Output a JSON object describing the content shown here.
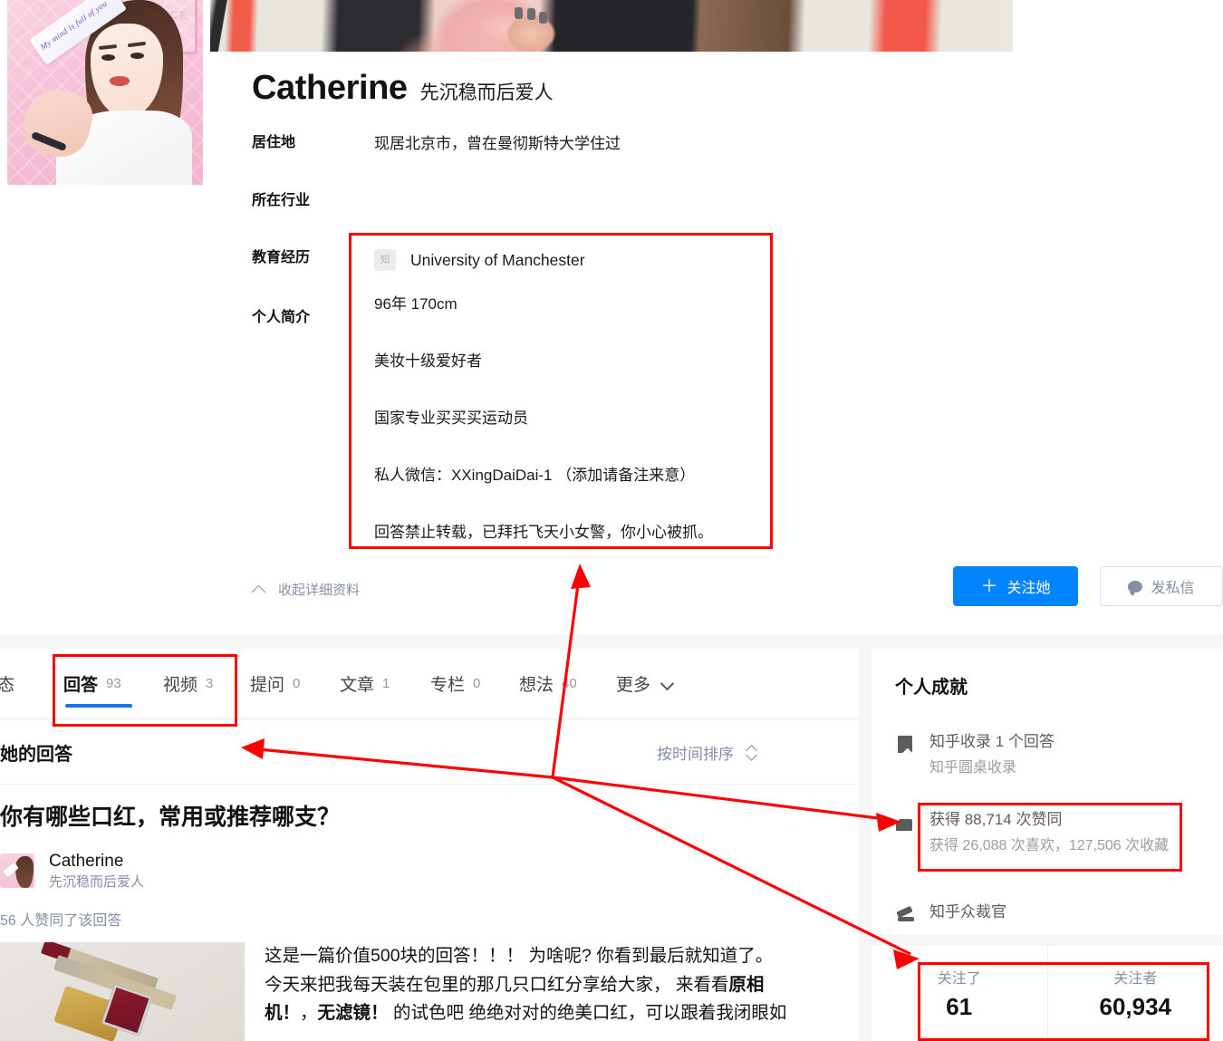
{
  "profile": {
    "name": "Catherine",
    "headline": "先沉稳而后爱人",
    "rows": [
      {
        "label": "居住地",
        "value": "现居北京市，曾在曼彻斯特大学住过"
      },
      {
        "label": "所在行业",
        "value": ""
      },
      {
        "label": "教育经历",
        "value": "University of Manchester"
      },
      {
        "label": "个人简介",
        "value": ""
      }
    ],
    "education_badge": "知",
    "education": "University of Manchester",
    "bio_lines": [
      "96年 170cm",
      "美妆十级爱好者",
      "国家专业买买买运动员",
      "私人微信：XXingDaiDai-1 （添加请备注来意）",
      "回答禁止转载，已拜托飞天小女警，你小心被抓。"
    ],
    "collapse_label": "收起详细资料",
    "follow_button": "关注她",
    "follow_plus": "＋",
    "message_button": "发私信"
  },
  "tabs": [
    {
      "label": "动态",
      "count": ""
    },
    {
      "label": "回答",
      "count": "93"
    },
    {
      "label": "视频",
      "count": "3"
    },
    {
      "label": "提问",
      "count": "0"
    },
    {
      "label": "文章",
      "count": "1"
    },
    {
      "label": "专栏",
      "count": "0"
    },
    {
      "label": "想法",
      "count": "40"
    },
    {
      "label": "更多",
      "count": ""
    }
  ],
  "list": {
    "title": "她的回答",
    "sort_label": "按时间排序"
  },
  "answer": {
    "question": "你有哪些口红，常用或推荐哪支？",
    "author": "Catherine",
    "author_bio": "先沉稳而后爱人",
    "votes": "56 人赞同了该回答",
    "body_p1": "这是一篇价值500块的回答！！！ 为啥呢? 你看到最后就知道了。",
    "body_p2_a": "今天来把我每天装在包里的那几只口红分享给大家， 来看看",
    "body_p2_b": "原相",
    "body_p3_a": "机！",
    "body_p3_b": "，",
    "body_p3_c": "无滤镜！",
    "body_p3_d": " 的试色吧 绝绝对对的绝美口红，可以跟着我闭眼如"
  },
  "achievements": {
    "title": "个人成就",
    "items": [
      {
        "icon": "book-icon",
        "primary": "知乎收录 1 个回答",
        "secondary": "知乎圆桌收录"
      },
      {
        "icon": "thumbs-up-icon",
        "primary": "获得 88,714 次赞同",
        "secondary": "获得 26,088 次喜欢，127,506 次收藏"
      },
      {
        "icon": "gavel-icon",
        "primary": "知乎众裁官",
        "secondary": ""
      }
    ]
  },
  "follow_stats": [
    {
      "label": "关注了",
      "value": "61"
    },
    {
      "label": "关注者",
      "value": "60,934"
    }
  ],
  "colors": {
    "accent_blue": "#0084ff",
    "tab_underline": "#1772f6",
    "annotation_red": "#ff0000",
    "muted": "#8590a6"
  }
}
